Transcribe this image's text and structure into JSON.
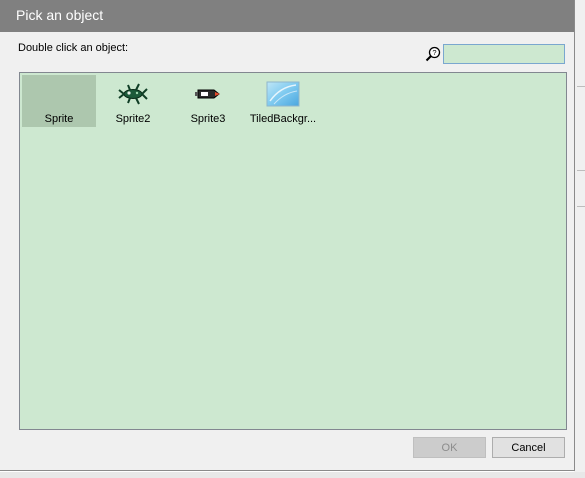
{
  "window": {
    "title": "Pick an object"
  },
  "prompt_text": "Double click an object:",
  "search": {
    "value": "",
    "placeholder": "",
    "icon": "search-help-icon"
  },
  "objects": [
    {
      "label": "Sprite",
      "icon": "blank-sprite-thumbnail",
      "selected": true
    },
    {
      "label": "Sprite2",
      "icon": "green-creature-sprite-thumbnail",
      "selected": false
    },
    {
      "label": "Sprite3",
      "icon": "rocket-ship-sprite-thumbnail",
      "selected": false
    },
    {
      "label": "TiledBackgr...",
      "icon": "sky-background-thumbnail",
      "selected": false
    }
  ],
  "buttons": {
    "ok": "OK",
    "cancel": "Cancel"
  },
  "colors": {
    "titlebar": "#808080",
    "panel_background": "#cde8d0",
    "selection": "#adc7ae"
  }
}
